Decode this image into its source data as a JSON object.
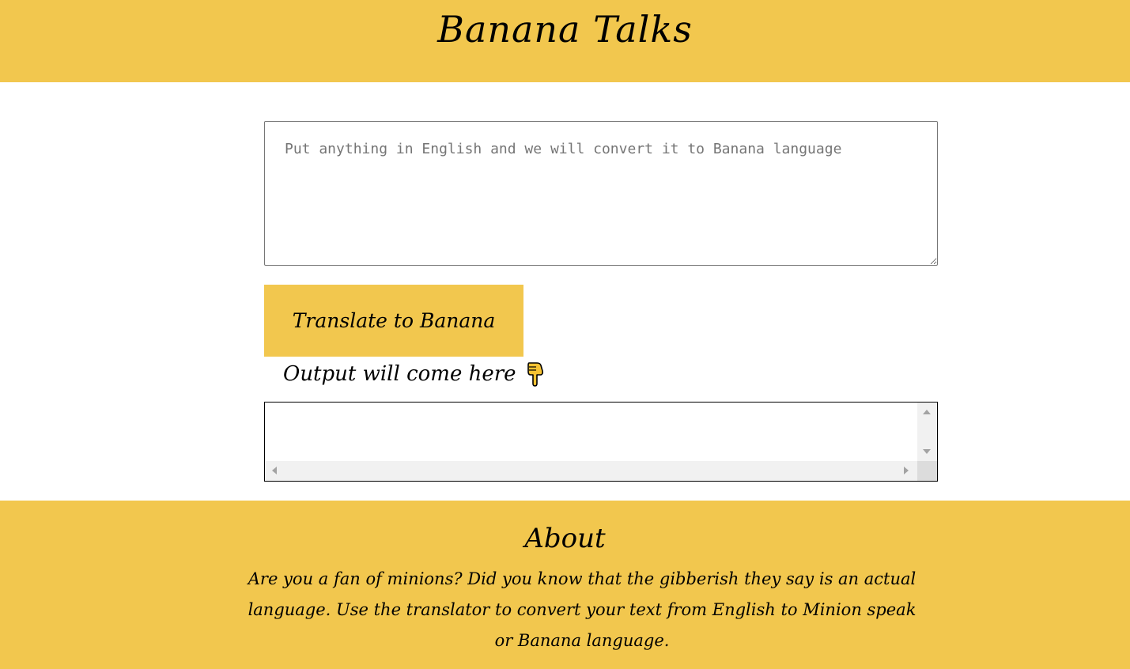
{
  "header": {
    "title": "Banana Talks"
  },
  "translator": {
    "input_placeholder": "Put anything in English and we will convert it to Banana language",
    "input_value": "",
    "button_label": "Translate to Banana",
    "output_label": "Output will come here",
    "output_icon": "pointing-down-hand-icon",
    "output_value": ""
  },
  "about": {
    "heading": "About",
    "text": "Are you a fan of minions? Did you know that the gibberish they say is an actual language. Use the translator to convert your text from English to Minion speak or Banana language."
  },
  "colors": {
    "accent": "#f2c74e",
    "text": "#000000",
    "background": "#ffffff"
  }
}
